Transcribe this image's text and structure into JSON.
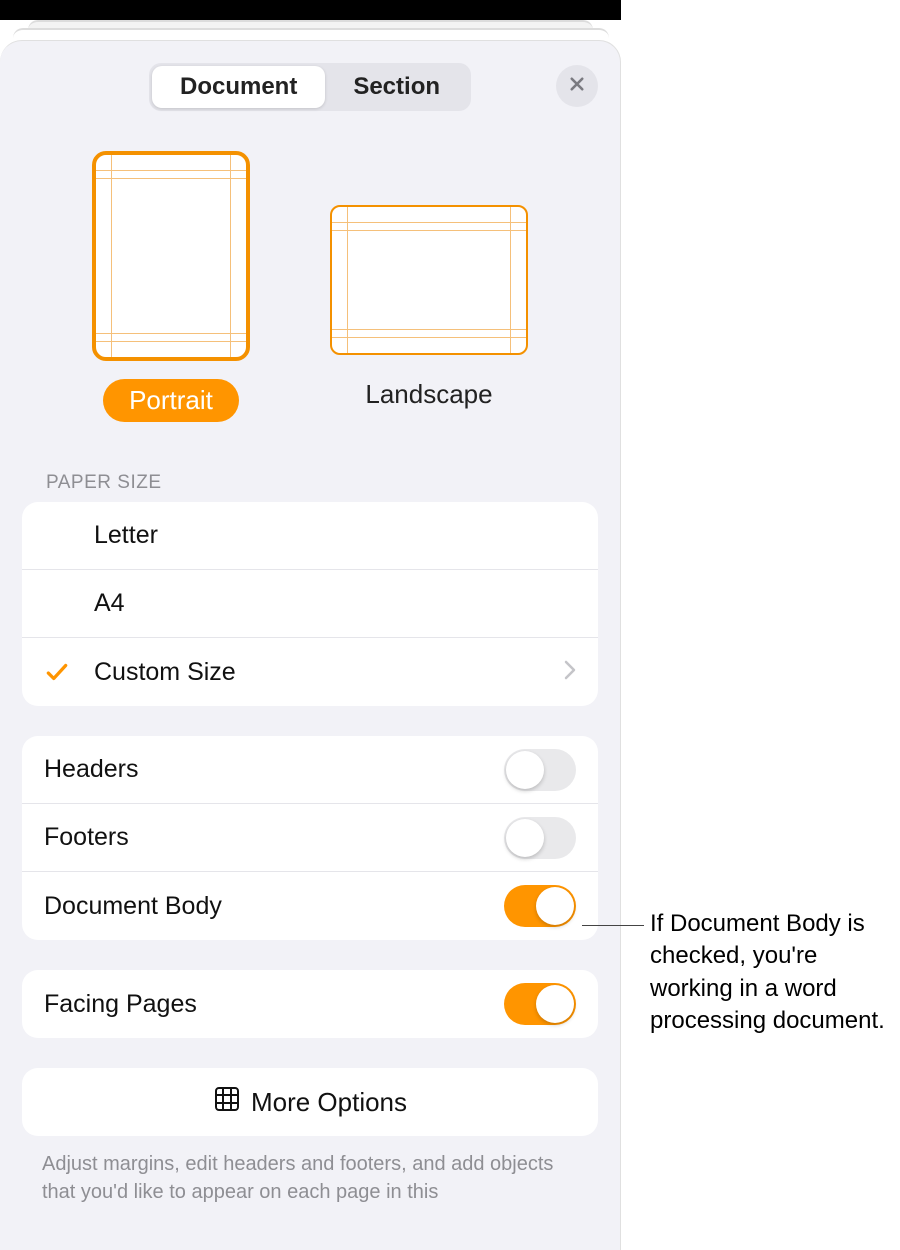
{
  "tabs": {
    "document": "Document",
    "section": "Section"
  },
  "orientation": {
    "portrait": "Portrait",
    "landscape": "Landscape"
  },
  "paperSize": {
    "header": "PAPER SIZE",
    "letter": "Letter",
    "a4": "A4",
    "custom": "Custom Size"
  },
  "toggles": {
    "headers": "Headers",
    "footers": "Footers",
    "documentBody": "Document Body",
    "facingPages": "Facing Pages"
  },
  "moreOptions": "More Options",
  "footerNote": "Adjust margins, edit headers and footers, and add objects that you'd like to appear on each page in this",
  "callout": "If Document Body is checked, you're working in a word processing document."
}
